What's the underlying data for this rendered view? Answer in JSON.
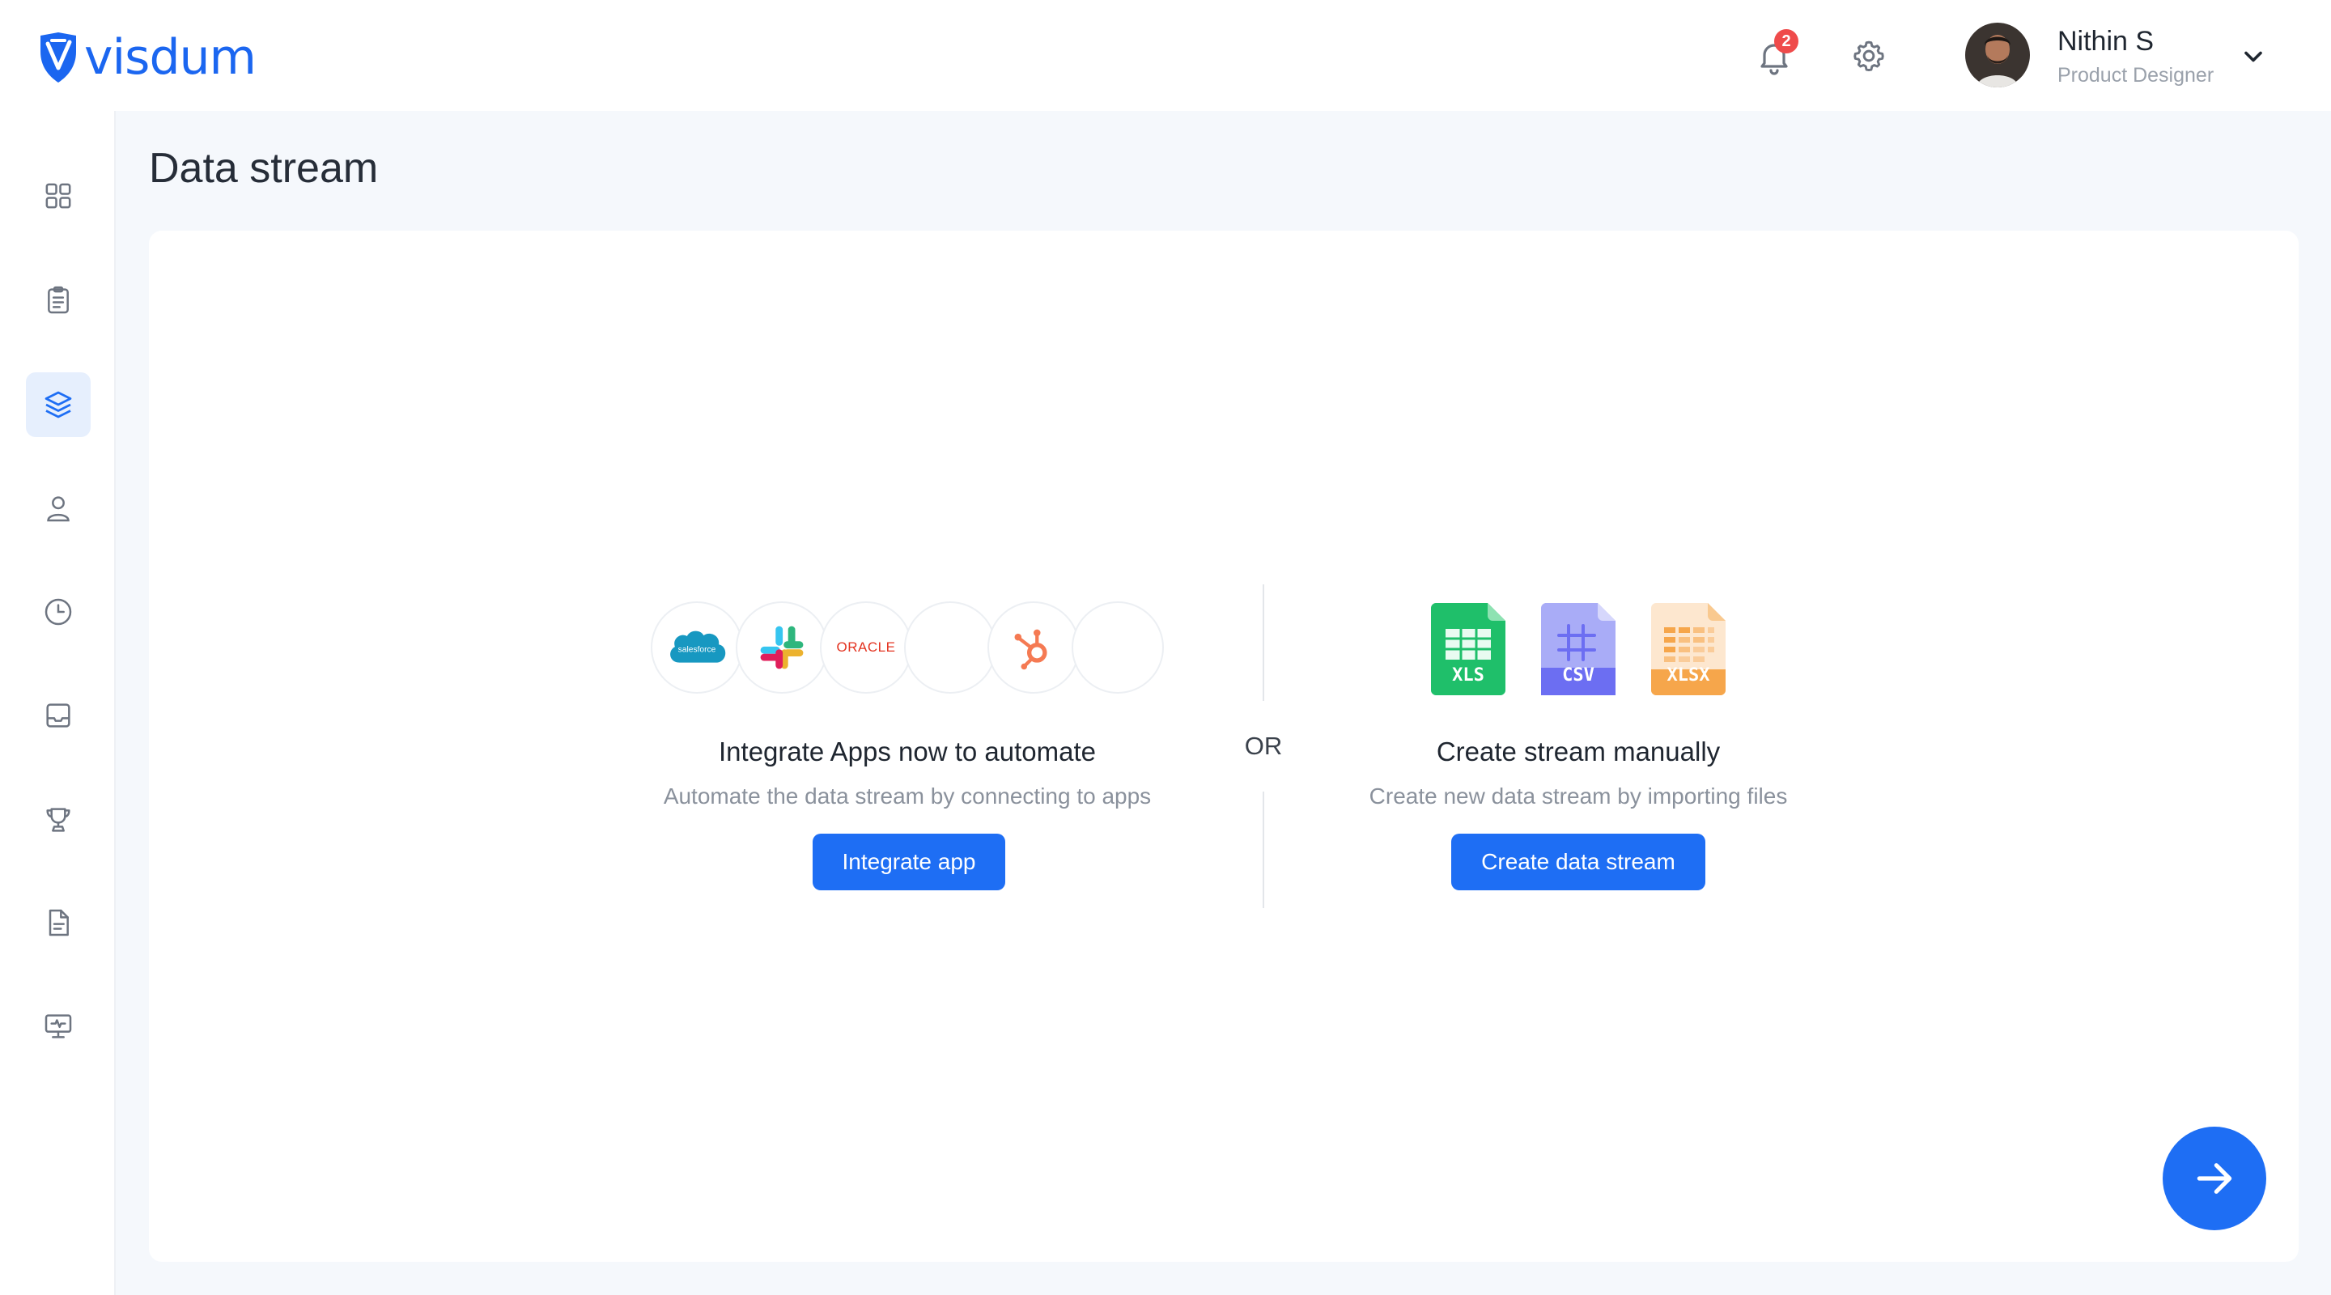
{
  "brand": {
    "name": "visdum",
    "color": "#1b66f0"
  },
  "header": {
    "notification_count": "2",
    "user": {
      "name": "Nithin S",
      "role": "Product Designer"
    }
  },
  "sidebar": {
    "active_index": 2,
    "items": [
      {
        "icon": "grid-icon"
      },
      {
        "icon": "clipboard-icon"
      },
      {
        "icon": "layers-icon"
      },
      {
        "icon": "user-icon"
      },
      {
        "icon": "clock-icon"
      },
      {
        "icon": "inbox-icon"
      },
      {
        "icon": "trophy-icon"
      },
      {
        "icon": "document-icon"
      },
      {
        "icon": "monitor-icon"
      }
    ]
  },
  "page": {
    "title": "Data stream"
  },
  "integrate": {
    "apps": [
      {
        "icon": "salesforce-logo",
        "label": "salesforce"
      },
      {
        "icon": "slack-logo"
      },
      {
        "icon": "oracle-logo",
        "label": "ORACLE"
      },
      {
        "icon": "blank-app-circle"
      },
      {
        "icon": "hubspot-logo"
      },
      {
        "icon": "blank-app-circle"
      }
    ],
    "title": "Integrate Apps now to automate",
    "subtitle": "Automate the data stream  by connecting to apps",
    "button": "Integrate app"
  },
  "separator": {
    "label": "OR"
  },
  "manual": {
    "files": [
      {
        "icon": "xls-file-icon",
        "label": "XLS",
        "color": "#1fbf6a"
      },
      {
        "icon": "csv-file-icon",
        "label": "CSV",
        "color": "#6c6ef2"
      },
      {
        "icon": "xlsx-file-icon",
        "label": "XLSX",
        "color": "#f6a64b"
      }
    ],
    "title": "Create stream manually",
    "subtitle": "Create new data stream  by importing files",
    "button": "Create data stream"
  },
  "colors": {
    "primary": "#1e6ef4",
    "badge": "#ef4b4b",
    "sidebar_active": "#e6effd"
  }
}
